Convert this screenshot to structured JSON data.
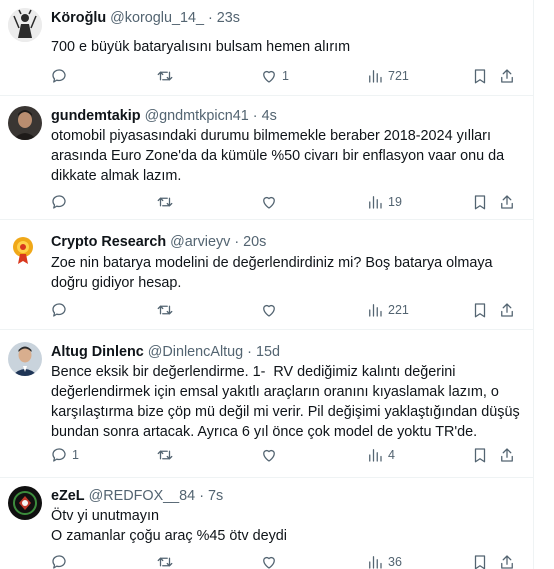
{
  "tweets": [
    {
      "name": "Köroğlu",
      "handle": "@koroglu_14_",
      "dot": "·",
      "time": "23s",
      "text": "700 e büyük bataryalısını bulsam hemen alırım",
      "replies": "",
      "retweets": "",
      "likes": "1",
      "views": "721",
      "avatar_icon": "warrior-silhouette"
    },
    {
      "name": "gundemtakip",
      "handle": "@gndmtkpicn41",
      "dot": "·",
      "time": "4s",
      "text": "otomobil piyasasındaki durumu bilmemekle beraber 2018-2024 yılları arasında Euro Zone'da da kümüle %50 civarı bir enflasyon vaar onu da dikkate almak lazım.",
      "replies": "",
      "retweets": "",
      "likes": "",
      "views": "19",
      "avatar_icon": "person-photo"
    },
    {
      "name": "Crypto Research",
      "handle": "@arvieyv",
      "dot": "·",
      "time": "20s",
      "text": "Zoe nin batarya modelini de değerlendirdiniz mi? Boş batarya olmaya doğru gidiyor hesap.",
      "replies": "",
      "retweets": "",
      "likes": "",
      "views": "221",
      "avatar_icon": "badge-logo"
    },
    {
      "name": "Altug Dinlenc",
      "handle": "@DinlencAltug",
      "dot": "·",
      "time": "15d",
      "text": "Bence eksik bir değerlendirme. 1-  RV dediğimiz kalıntı değerini değerlendirmek için emsal yakıtlı araçların oranını kıyaslamak lazım, o karşılaştırma bize çöp mü değil mi verir. Pil değişimi yaklaştığından düşüş bundan sonra artacak. Ayrıca 6 yıl önce çok model de yoktu TR'de.",
      "replies": "1",
      "retweets": "",
      "likes": "",
      "views": "4",
      "avatar_icon": "person-photo"
    },
    {
      "name": "eZeL",
      "handle": "@REDFOX__84",
      "dot": "·",
      "time": "7s",
      "text": "Ötv yi unutmayın\nO zamanlar çoğu araç %45 ötv deydi",
      "replies": "",
      "retweets": "",
      "likes": "",
      "views": "36",
      "avatar_icon": "dark-emblem"
    }
  ],
  "icons": {
    "reply": "reply-icon",
    "retweet": "retweet-icon",
    "like": "heart-icon",
    "views": "views-icon",
    "bookmark": "bookmark-icon",
    "share": "share-icon"
  },
  "colors": {
    "text": "#0f1419",
    "secondary": "#536471",
    "divider": "#eff3f4"
  }
}
